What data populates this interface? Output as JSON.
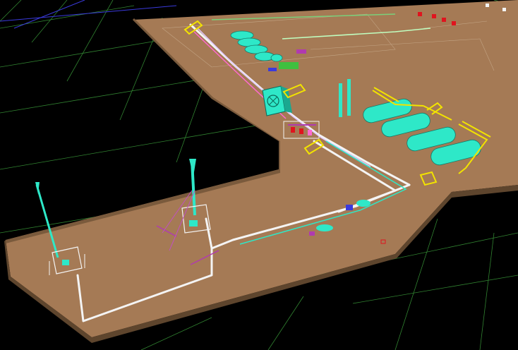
{
  "viewport": {
    "kind": "3d-plant-model-view",
    "background": "#000000",
    "grid_color": "#3fa83f",
    "terrain_color": "#a57a55",
    "equipment_color": "#2ee8c8",
    "platform_color": "#f2e300",
    "piping_color": "#f4f4f4",
    "marker_color": "#e0141e"
  },
  "scene": {
    "objects": [
      {
        "name": "left-flare-stack",
        "type": "flare"
      },
      {
        "name": "center-flare-stack",
        "type": "flare"
      },
      {
        "name": "main-pipe-rack",
        "type": "piping"
      },
      {
        "name": "storage-vessels",
        "type": "vessel",
        "count": 4
      },
      {
        "name": "process-tanks",
        "type": "vessel",
        "count": 5
      },
      {
        "name": "air-cooler",
        "type": "cooler"
      },
      {
        "name": "distillation-columns",
        "type": "column",
        "count": 2
      },
      {
        "name": "access-stairs",
        "type": "platform"
      },
      {
        "name": "red-markers",
        "type": "marker",
        "count": 4
      }
    ]
  }
}
